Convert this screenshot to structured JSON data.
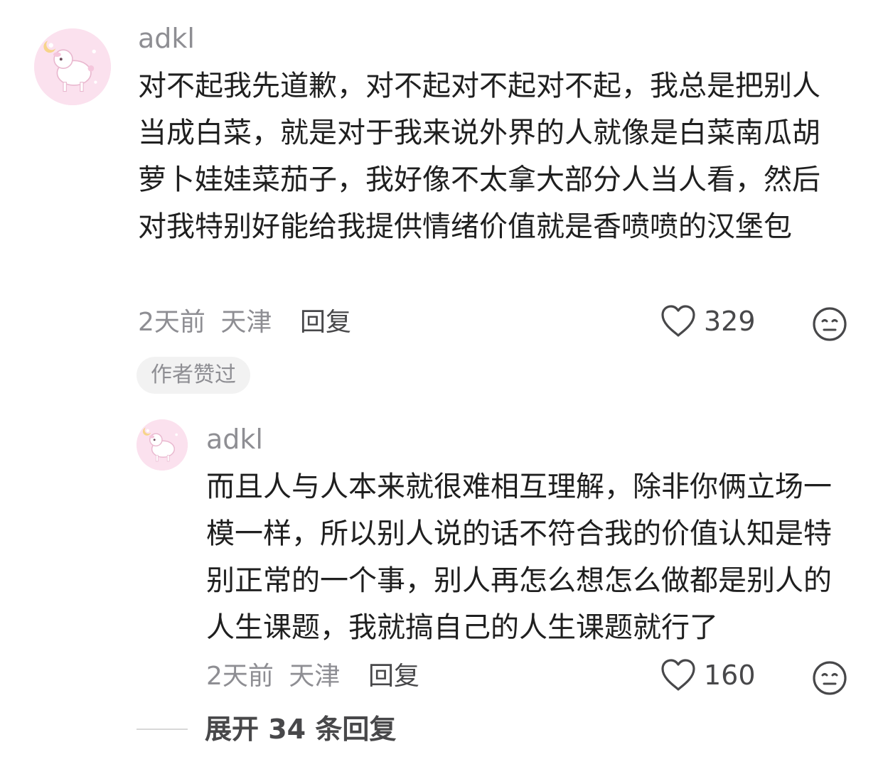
{
  "comments": [
    {
      "username": "adkl",
      "avatar_icon": "lamb-avatar-icon",
      "content": "对不起我先道歉，对不起对不起对不起，我总是把别人当成白菜，就是对于我来说外界的人就像是白菜南瓜胡萝卜娃娃菜茄子，我好像不太拿大部分人当人看，然后对我特别好能给我提供情绪价值就是香喷喷的汉堡包",
      "time": "2天前",
      "location": "天津",
      "reply_label": "回复",
      "like_count": "329",
      "badge": "作者赞过"
    }
  ],
  "replies": [
    {
      "username": "adkl",
      "avatar_icon": "lamb-avatar-icon",
      "content": "而且人与人本来就很难相互理解，除非你俩立场一模一样，所以别人说的话不符合我的价值认知是特别正常的一个事，别人再怎么想怎么做都是别人的人生课题，我就搞自己的人生课题就行了",
      "time": "2天前",
      "location": "天津",
      "reply_label": "回复",
      "like_count": "160"
    }
  ],
  "expand": {
    "label": "展开 34 条回复"
  },
  "colors": {
    "text_primary": "#1f1f1f",
    "text_secondary": "#8e8e93",
    "badge_bg": "#f2f2f2",
    "avatar_pink": "#fbdcea"
  }
}
